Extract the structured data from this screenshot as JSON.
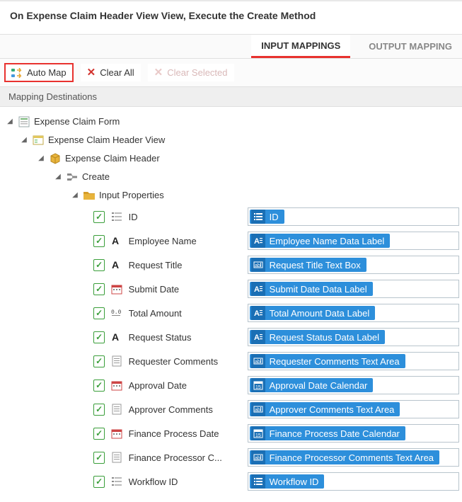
{
  "header": {
    "title": "On Expense Claim Header View View, Execute the Create Method"
  },
  "tabs": {
    "input": "INPUT MAPPINGS",
    "output": "OUTPUT MAPPING"
  },
  "toolbar": {
    "automap": "Auto Map",
    "clearall": "Clear All",
    "clearsel": "Clear Selected"
  },
  "section": "Mapping Destinations",
  "tree": {
    "form": "Expense Claim Form",
    "view": "Expense Claim Header View",
    "so": "Expense Claim Header",
    "method": "Create",
    "inputprops": "Input Properties"
  },
  "props": [
    {
      "label": "ID",
      "chip": "ID",
      "icon": "list",
      "chipicon": "list"
    },
    {
      "label": "Employee Name",
      "chip": "Employee Name Data Label",
      "icon": "text",
      "chipicon": "label"
    },
    {
      "label": "Request Title",
      "chip": "Request Title Text Box",
      "icon": "text",
      "chipicon": "textbox"
    },
    {
      "label": "Submit Date",
      "chip": "Submit Date Data Label",
      "icon": "calendar",
      "chipicon": "label"
    },
    {
      "label": "Total Amount",
      "chip": "Total Amount Data Label",
      "icon": "number",
      "chipicon": "label"
    },
    {
      "label": "Request Status",
      "chip": "Request Status Data Label",
      "icon": "text",
      "chipicon": "label"
    },
    {
      "label": "Requester Comments",
      "chip": "Requester Comments Text Area",
      "icon": "memo",
      "chipicon": "textbox"
    },
    {
      "label": "Approval Date",
      "chip": "Approval Date Calendar",
      "icon": "calendar",
      "chipicon": "datecal"
    },
    {
      "label": "Approver Comments",
      "chip": "Approver Comments Text Area",
      "icon": "memo",
      "chipicon": "textbox"
    },
    {
      "label": "Finance Process Date",
      "chip": "Finance Process Date Calendar",
      "icon": "calendar",
      "chipicon": "datecal"
    },
    {
      "label": "Finance Processor C...",
      "chip": "Finance Processor Comments Text Area",
      "icon": "memo",
      "chipicon": "textbox"
    },
    {
      "label": "Workflow ID",
      "chip": "Workflow ID",
      "icon": "list",
      "chipicon": "list"
    }
  ]
}
